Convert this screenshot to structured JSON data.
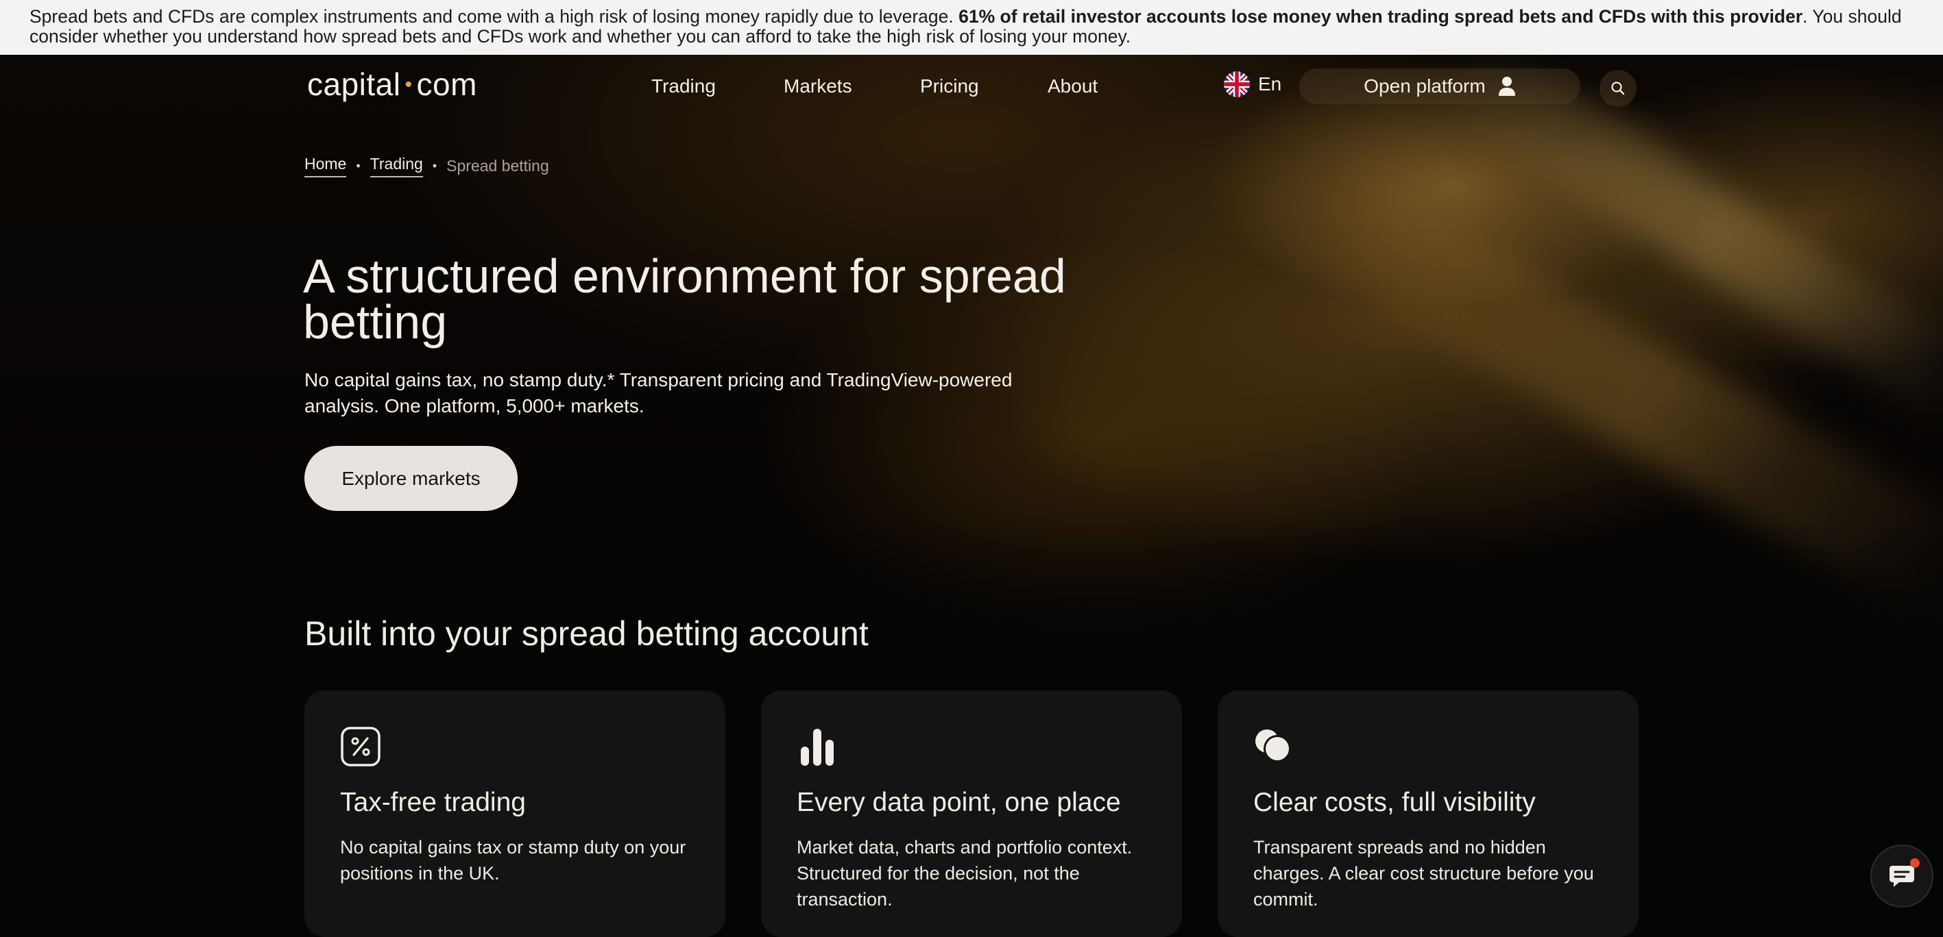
{
  "risk_banner": {
    "text_start": "Spread bets and CFDs are complex instruments and come with a high risk of losing money rapidly due to leverage. ",
    "text_bold": "61% of retail investor accounts lose money when trading spread bets and CFDs with this provider",
    "text_end": ". You should consider whether you understand how spread bets and CFDs work and whether you can afford to take the high risk of losing your money."
  },
  "header": {
    "logo_left": "capital",
    "logo_dot": "•",
    "logo_right": "com",
    "nav": [
      {
        "label": "Trading"
      },
      {
        "label": "Markets"
      },
      {
        "label": "Pricing"
      },
      {
        "label": "About"
      }
    ],
    "language": "En",
    "open_platform": "Open platform"
  },
  "breadcrumb": {
    "items": [
      {
        "label": "Home"
      },
      {
        "label": "Trading"
      },
      {
        "label": "Spread betting"
      }
    ],
    "separator": "•"
  },
  "hero": {
    "title": "A structured environment for spread betting",
    "subtitle": "No capital gains tax, no stamp duty.* Transparent pricing and TradingView-powered analysis. One platform, 5,000+ markets.",
    "cta": "Explore markets"
  },
  "features": {
    "title": "Built into your spread betting account",
    "cards": [
      {
        "icon": "percent-icon",
        "title": "Tax-free trading",
        "text": "No capital gains tax or stamp duty on your positions in the UK."
      },
      {
        "icon": "bar-chart-icon",
        "title": "Every data point, one place",
        "text": "Market data, charts and portfolio context. Structured for the decision, not the transaction."
      },
      {
        "icon": "coins-icon",
        "title": "Clear costs, full visibility",
        "text": "Transparent spreads and no hidden charges. A clear cost structure before you commit."
      }
    ]
  },
  "colors": {
    "banner_bg": "#f3f3f3",
    "page_bg": "#050505",
    "accent_gold": "#e0a43a",
    "card_bg": "#141414",
    "cta_bg": "#e8e3de",
    "notification_dot": "#e2462e"
  }
}
